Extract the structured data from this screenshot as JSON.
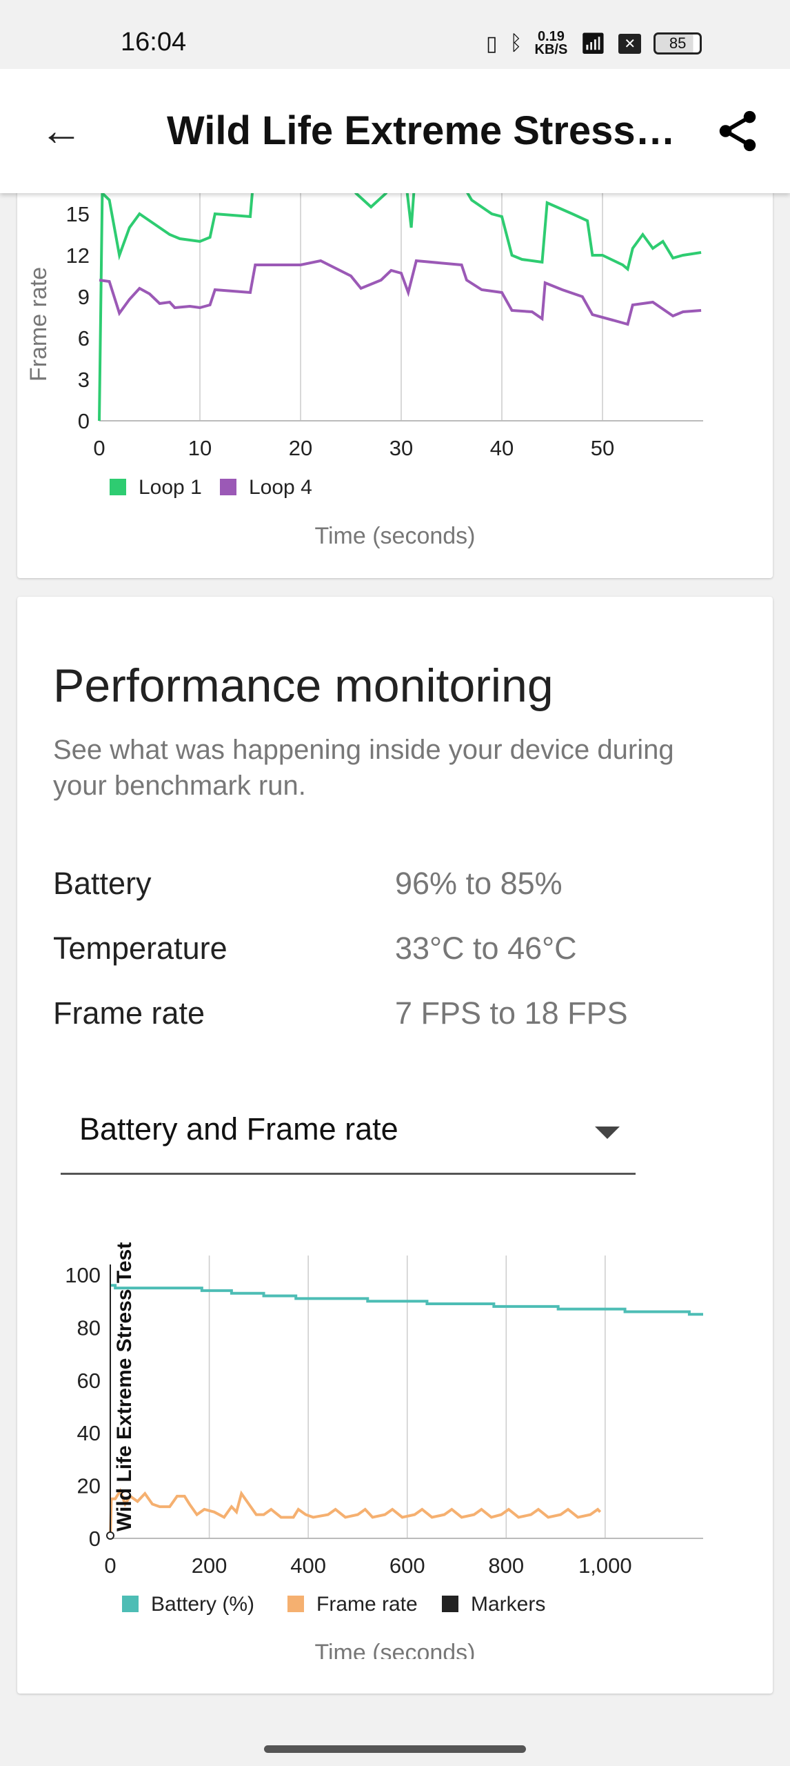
{
  "status_bar": {
    "time": "16:04",
    "net_speed_value": "0.19",
    "net_speed_unit": "KB/S",
    "battery": "85"
  },
  "app_bar": {
    "title": "Wild Life Extreme Stress Test",
    "back_icon": "arrow-left-icon",
    "share_icon": "share-icon"
  },
  "performance": {
    "title": "Performance monitoring",
    "subtitle": "See what was happening inside your device during your benchmark run.",
    "rows": [
      {
        "label": "Battery",
        "value": "96% to 85%"
      },
      {
        "label": "Temperature",
        "value": "33°C to 46°C"
      },
      {
        "label": "Frame rate",
        "value": "7 FPS to 18 FPS"
      }
    ],
    "dropdown": {
      "selected": "Battery and Frame rate"
    }
  },
  "chart_data": [
    {
      "type": "line",
      "ylabel": "Frame rate",
      "xlabel": "Time (seconds)",
      "xlim": [
        0,
        60
      ],
      "ylim": [
        0,
        18
      ],
      "x_ticks": [
        "0",
        "10",
        "20",
        "30",
        "40",
        "50"
      ],
      "y_ticks": [
        "0",
        "3",
        "6",
        "9",
        "12",
        "15"
      ],
      "grid": "vertical",
      "legend": "bottom-left",
      "series": [
        {
          "name": "Loop 1",
          "color": "#2ecc71",
          "points": [
            [
              0,
              0
            ],
            [
              0.3,
              16.5
            ],
            [
              1,
              16
            ],
            [
              2,
              12
            ],
            [
              3,
              14
            ],
            [
              4,
              15
            ],
            [
              5,
              14.5
            ],
            [
              6,
              14
            ],
            [
              7,
              13.5
            ],
            [
              8,
              13.2
            ],
            [
              10,
              13
            ],
            [
              11,
              13.3
            ],
            [
              11.5,
              15
            ],
            [
              15,
              14.8
            ],
            [
              15.5,
              19
            ],
            [
              24,
              19
            ],
            [
              25.5,
              16.5
            ],
            [
              27,
              15.5
            ],
            [
              28.5,
              16.5
            ],
            [
              29.5,
              18.5
            ],
            [
              30.2,
              19
            ],
            [
              31,
              14
            ],
            [
              31.5,
              19
            ],
            [
              35.5,
              19
            ],
            [
              36.2,
              17
            ],
            [
              37,
              16
            ],
            [
              39,
              15
            ],
            [
              40,
              14.8
            ],
            [
              41,
              12
            ],
            [
              42,
              11.7
            ],
            [
              44,
              11.5
            ],
            [
              44.5,
              15.8
            ],
            [
              47,
              15
            ],
            [
              48.5,
              14.5
            ],
            [
              49,
              12
            ],
            [
              50,
              12
            ],
            [
              52,
              11.3
            ],
            [
              52.5,
              11
            ],
            [
              53,
              12.5
            ],
            [
              54,
              13.5
            ],
            [
              55,
              12.5
            ],
            [
              56,
              13
            ],
            [
              57,
              11.8
            ],
            [
              58,
              12
            ],
            [
              59.8,
              12.2
            ]
          ]
        },
        {
          "name": "Loop 4",
          "color": "#9b59b6",
          "points": [
            [
              0,
              10.2
            ],
            [
              1,
              10.1
            ],
            [
              2,
              7.8
            ],
            [
              3,
              8.8
            ],
            [
              4,
              9.6
            ],
            [
              5,
              9.2
            ],
            [
              6,
              8.5
            ],
            [
              7,
              8.6
            ],
            [
              7.5,
              8.2
            ],
            [
              9,
              8.3
            ],
            [
              10,
              8.2
            ],
            [
              11,
              8.4
            ],
            [
              11.5,
              9.5
            ],
            [
              15,
              9.3
            ],
            [
              15.5,
              11.3
            ],
            [
              20,
              11.3
            ],
            [
              22,
              11.6
            ],
            [
              25,
              10.5
            ],
            [
              26,
              9.6
            ],
            [
              28,
              10.2
            ],
            [
              29,
              10.9
            ],
            [
              30,
              10.7
            ],
            [
              30.7,
              9.3
            ],
            [
              31.5,
              11.6
            ],
            [
              36,
              11.3
            ],
            [
              36.5,
              10.2
            ],
            [
              38,
              9.5
            ],
            [
              40,
              9.3
            ],
            [
              41,
              8
            ],
            [
              43,
              7.9
            ],
            [
              44,
              7.4
            ],
            [
              44.3,
              10
            ],
            [
              46,
              9.5
            ],
            [
              48,
              9
            ],
            [
              49,
              7.7
            ],
            [
              52,
              7.1
            ],
            [
              52.5,
              7
            ],
            [
              53,
              8.4
            ],
            [
              55,
              8.6
            ],
            [
              57,
              7.6
            ],
            [
              58,
              7.9
            ],
            [
              59.8,
              8
            ]
          ]
        }
      ]
    },
    {
      "type": "line",
      "xlabel": "Time (seconds)",
      "xlim": [
        0,
        1198
      ],
      "ylim": [
        0,
        100
      ],
      "x_ticks": [
        "0",
        "200",
        "400",
        "600",
        "800",
        "1,000"
      ],
      "y_ticks": [
        "0",
        "20",
        "40",
        "60",
        "80",
        "100"
      ],
      "grid": "vertical",
      "legend": "bottom-left",
      "marker": {
        "label": "Wild Life Extreme Stress Test",
        "x": 0
      },
      "series": [
        {
          "name": "Battery (%)",
          "color": "#4dbdb5",
          "step": true,
          "points": [
            [
              0,
              96
            ],
            [
              10,
              95
            ],
            [
              185,
              94
            ],
            [
              245,
              93
            ],
            [
              310,
              92
            ],
            [
              375,
              91
            ],
            [
              520,
              90
            ],
            [
              640,
              89
            ],
            [
              775,
              88
            ],
            [
              905,
              87
            ],
            [
              1040,
              86
            ],
            [
              1170,
              85
            ],
            [
              1198,
              85
            ]
          ]
        },
        {
          "name": "Frame rate",
          "color": "#f5b070",
          "points": [
            [
              0,
              0
            ],
            [
              2,
              15
            ],
            [
              10,
              15
            ],
            [
              20,
              18
            ],
            [
              30,
              13
            ],
            [
              40,
              16
            ],
            [
              55,
              14
            ],
            [
              70,
              17
            ],
            [
              85,
              13
            ],
            [
              100,
              12
            ],
            [
              120,
              12
            ],
            [
              135,
              16
            ],
            [
              150,
              16
            ],
            [
              160,
              13
            ],
            [
              175,
              9
            ],
            [
              190,
              11
            ],
            [
              210,
              10
            ],
            [
              230,
              8
            ],
            [
              245,
              12
            ],
            [
              255,
              10
            ],
            [
              265,
              17
            ],
            [
              280,
              13
            ],
            [
              295,
              9
            ],
            [
              310,
              9
            ],
            [
              325,
              11
            ],
            [
              345,
              8
            ],
            [
              370,
              8
            ],
            [
              380,
              11
            ],
            [
              395,
              9
            ],
            [
              410,
              8
            ],
            [
              440,
              9
            ],
            [
              455,
              11
            ],
            [
              475,
              8
            ],
            [
              500,
              9
            ],
            [
              515,
              11
            ],
            [
              530,
              8
            ],
            [
              555,
              9
            ],
            [
              570,
              11
            ],
            [
              590,
              8
            ],
            [
              615,
              9
            ],
            [
              630,
              11
            ],
            [
              650,
              8
            ],
            [
              675,
              9
            ],
            [
              690,
              11
            ],
            [
              710,
              8
            ],
            [
              735,
              9
            ],
            [
              750,
              11
            ],
            [
              770,
              8
            ],
            [
              790,
              9
            ],
            [
              805,
              11
            ],
            [
              825,
              8
            ],
            [
              850,
              9
            ],
            [
              865,
              11
            ],
            [
              885,
              8
            ],
            [
              910,
              9
            ],
            [
              925,
              11
            ],
            [
              945,
              8
            ],
            [
              970,
              9
            ],
            [
              985,
              11
            ],
            [
              990,
              10
            ]
          ]
        },
        {
          "name": "Markers",
          "color": "#222222",
          "points": []
        }
      ]
    }
  ]
}
